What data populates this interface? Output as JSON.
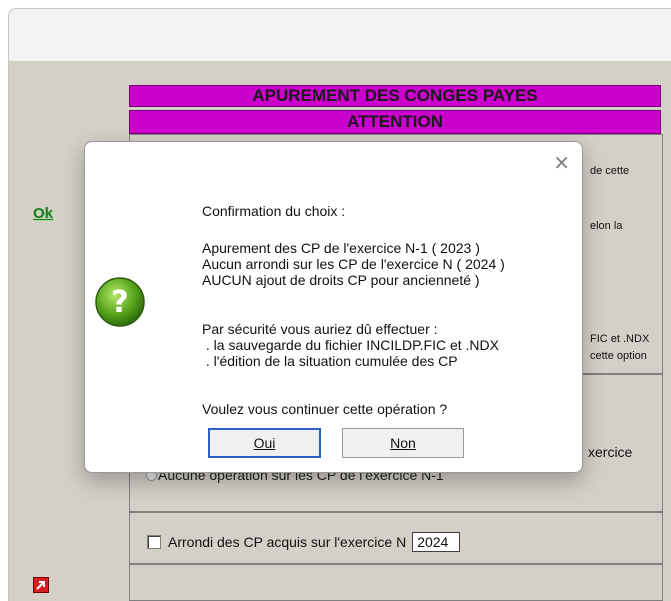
{
  "banner": {
    "title": "APUREMENT DES CONGES PAYES",
    "attention": "ATTENTION"
  },
  "background": {
    "ok_link": "Ok",
    "right_fragments": [
      "de cette",
      "elon la",
      "FIC et .NDX",
      "cette option",
      "xercice"
    ],
    "radio_option": "Aucune opération sur les CP de l'exercice N-1",
    "checkbox_label": "Arrondi des CP acquis sur l'exercice N",
    "year_value": "2024"
  },
  "dialog": {
    "close_glyph": "×",
    "icon": "question-icon",
    "line_confirm": "Confirmation du choix :",
    "line_apurement": "Apurement des CP de l'exercice N-1 ( 2023 )",
    "line_arrondi": "Aucun arrondi sur les CP de l'exercice N ( 2024 )",
    "line_ajout": "AUCUN ajout de droits CP pour ancienneté )",
    "line_securite": "Par sécurité vous auriez dû effectuer :",
    "line_sauvegarde": " . la sauvegarde du fichier INCILDP.FIC et .NDX",
    "line_edition": " . l'édition de la situation cumulée des CP",
    "line_question": "Voulez vous continuer cette opération ?",
    "oui_label": "Oui",
    "non_label": "Non"
  },
  "colors": {
    "banner": "#cc00cc",
    "ok_green": "#1d7a1d",
    "focus_blue": "#2b62c4",
    "window_bg": "#d4d0c8"
  }
}
